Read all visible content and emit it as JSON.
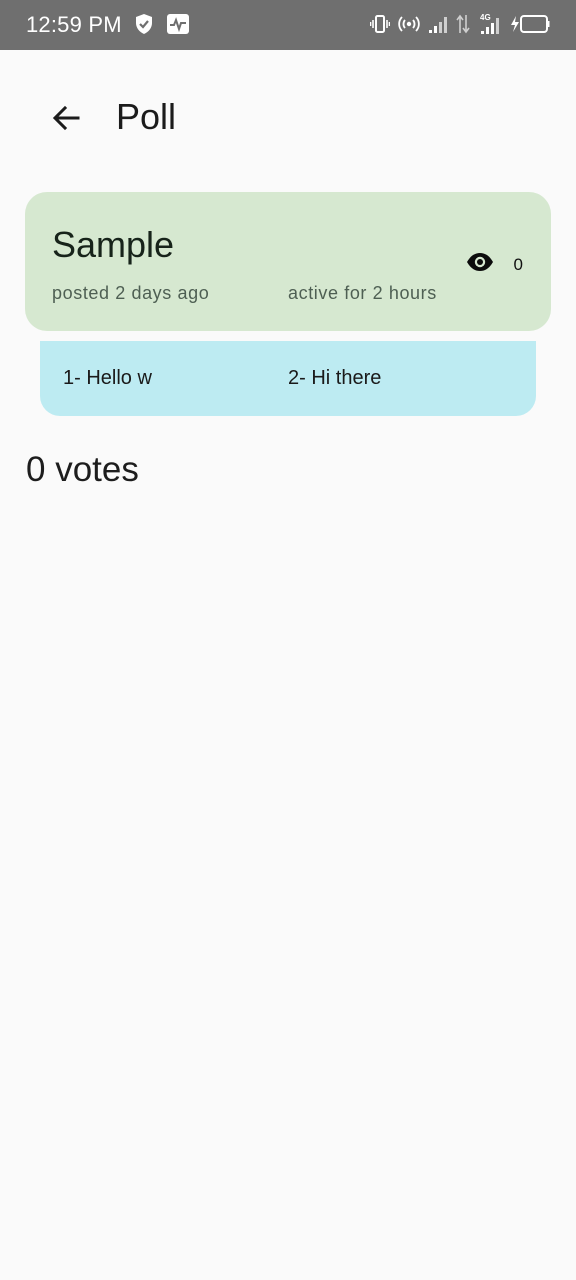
{
  "status_bar": {
    "time": "12:59 PM",
    "left_icons": [
      "shield-check-icon",
      "activity-icon"
    ],
    "right_icons": [
      "vibrate-icon",
      "hotspot-icon",
      "signal-icon",
      "data-arrows-icon",
      "signal-4g-icon",
      "battery-charging-icon"
    ],
    "network_label": "4G"
  },
  "app_bar": {
    "title": "Poll",
    "back_icon": "arrow-back-icon"
  },
  "poll": {
    "title": "Sample",
    "views_count": "0",
    "views_icon": "eye-icon",
    "posted": "posted 2 days ago",
    "active": "active for 2 hours",
    "options": [
      {
        "label": "1- Hello w"
      },
      {
        "label": "2- Hi there"
      }
    ]
  },
  "votes": {
    "total_label": "0 votes"
  },
  "colors": {
    "status_bar_bg": "#6f6f6f",
    "page_bg": "#fafafa",
    "poll_card_bg": "#d6e8d0",
    "options_bg": "#bdebf2"
  }
}
